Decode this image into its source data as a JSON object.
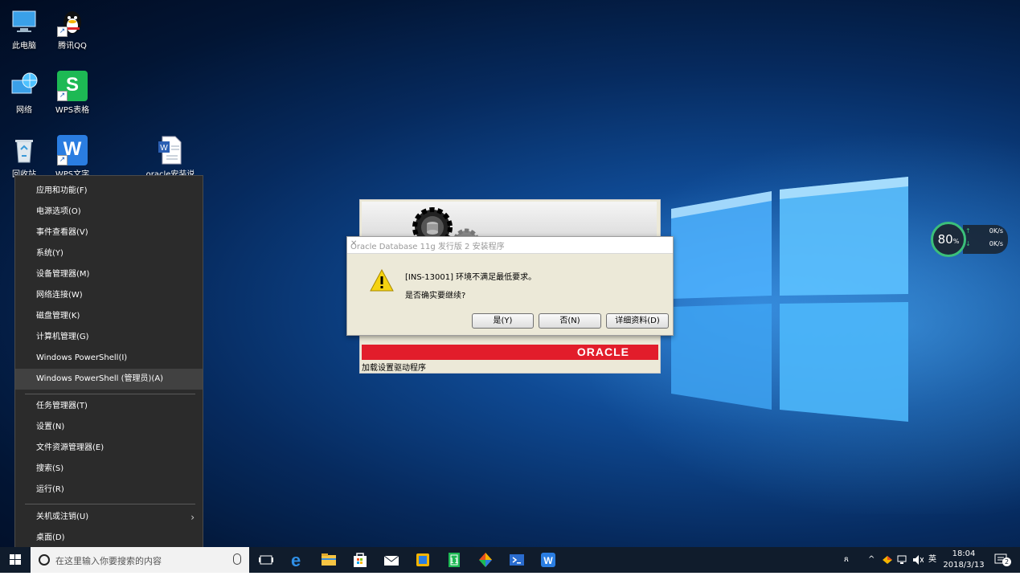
{
  "desktop": {
    "icons": [
      {
        "label": "此电脑",
        "icon": "computer-icon"
      },
      {
        "label": "腾讯QQ",
        "icon": "qq-penguin-icon"
      },
      {
        "label": "网络",
        "icon": "network-globe-icon"
      },
      {
        "label": "WPS表格",
        "icon": "wps-spreadsheet-icon"
      },
      {
        "label": "回收站",
        "icon": "recycle-bin-icon"
      },
      {
        "label": "WPS文字",
        "icon": "wps-writer-icon"
      },
      {
        "label": "oracle安装说",
        "icon": "word-document-icon"
      }
    ]
  },
  "netmon": {
    "percent": "80",
    "percent_unit": "%",
    "upload": "0K/s",
    "download": "0K/s"
  },
  "oracle_installer": {
    "brand": "ORACLE",
    "status": "加载设置驱动程序"
  },
  "dialog": {
    "title": "Oracle Database 11g 发行版 2 安装程序",
    "message": "[INS-13001] 环境不满足最低要求。",
    "question": "是否确实要继续?",
    "buttons": {
      "yes": "是(Y)",
      "no": "否(N)",
      "details": "详细资料(D)"
    }
  },
  "context_menu": {
    "items": [
      "应用和功能(F)",
      "电源选项(O)",
      "事件查看器(V)",
      "系统(Y)",
      "设备管理器(M)",
      "网络连接(W)",
      "磁盘管理(K)",
      "计算机管理(G)",
      "Windows PowerShell(I)",
      "Windows PowerShell (管理员)(A)",
      "任务管理器(T)",
      "设置(N)",
      "文件资源管理器(E)",
      "搜索(S)",
      "运行(R)",
      "关机或注销(U)",
      "桌面(D)"
    ],
    "highlighted": "Windows PowerShell (管理员)(A)"
  },
  "taskbar": {
    "search_placeholder": "在这里输入你要搜索的内容",
    "apps": [
      "task-view-icon",
      "edge-icon",
      "file-explorer-icon",
      "store-icon",
      "mail-icon",
      "sticky-app-icon",
      "green-app-icon",
      "photos-app-icon",
      "powershell-icon",
      "wps-writer-icon"
    ],
    "ime": "英",
    "time": "18:04",
    "date": "2018/3/13",
    "notification_count": "2"
  },
  "colors": {
    "oracle_red": "#e21d2b",
    "menu_bg": "#2b2b2b",
    "taskbar_bg": "#101c2c"
  }
}
